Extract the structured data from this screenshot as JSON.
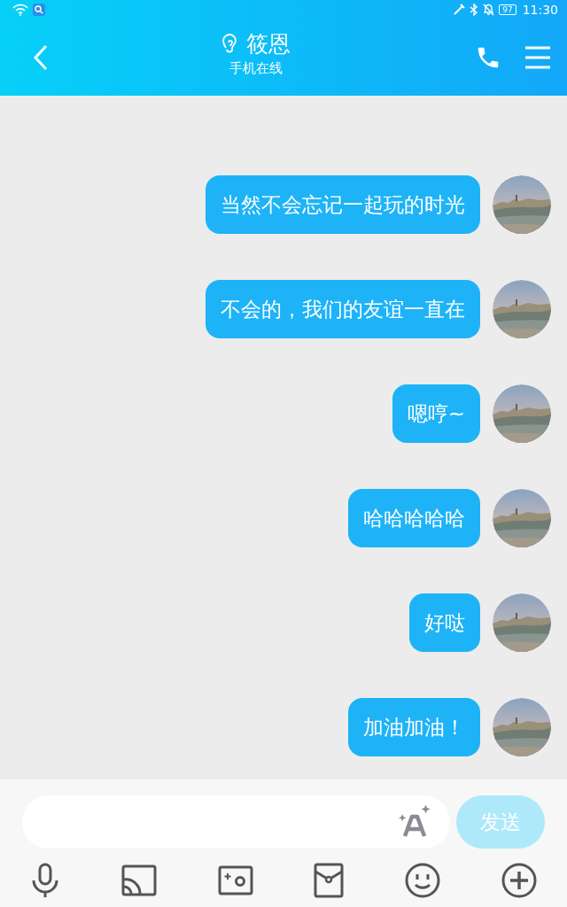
{
  "status_bar": {
    "battery": "97",
    "time": "11:30"
  },
  "header": {
    "name": "筱恩",
    "status": "手机在线"
  },
  "messages": [
    {
      "text": "当然不会忘记一起玩的时光"
    },
    {
      "text": "不会的，我们的友谊一直在"
    },
    {
      "text": "嗯哼~"
    },
    {
      "text": "哈哈哈哈哈"
    },
    {
      "text": "好哒"
    },
    {
      "text": "加油加油！"
    }
  ],
  "composer": {
    "send": "发送"
  }
}
